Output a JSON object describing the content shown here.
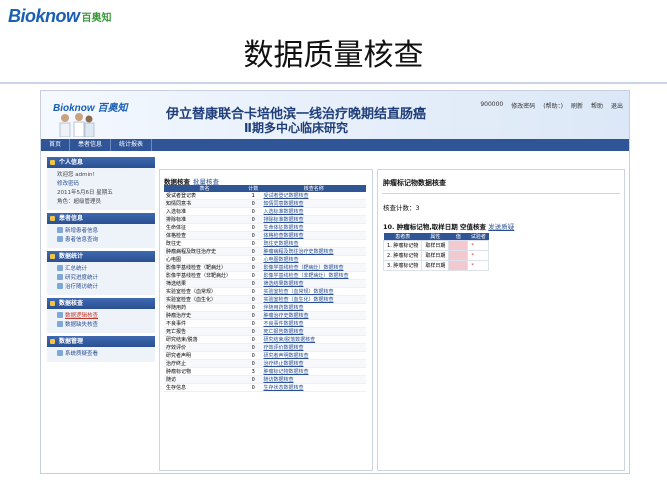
{
  "slide": {
    "logo_text": "Bioknow",
    "logo_cn": "百奥知",
    "title": "数据质量核查"
  },
  "app": {
    "banner_logo": "Bioknow 百奥知",
    "banner_title_1": "伊立替康联合卡培他滨一线治疗晚期结直肠癌",
    "banner_title_2": "Ⅱ期多中心临床研究",
    "top_links": [
      "900000",
      "修改密码",
      "(帮助：)",
      "刷新",
      "帮助",
      "退出"
    ],
    "nav_tabs": [
      "首页",
      "患者信息",
      "统计报表"
    ]
  },
  "sidebar": {
    "sections": [
      {
        "title": "个人信息",
        "items": [
          "欢迎您 admin!",
          "修改密码",
          "2011年5月6日 星期五",
          "角色：超级管理员"
        ]
      },
      {
        "title": "患者信息",
        "items": [
          "新增患者信息",
          "患者信息查询"
        ]
      },
      {
        "title": "数据统计",
        "items": [
          "汇总统计",
          "研究进度统计",
          "治疗随访统计"
        ]
      },
      {
        "title": "数据核查",
        "items": [
          "数据逻辑核查",
          "数据缺失核查"
        ]
      },
      {
        "title": "数据管理",
        "items": [
          "系统质疑查看"
        ]
      }
    ]
  },
  "check_panel": {
    "title": "数据核查",
    "title_link": "批量核查",
    "columns": [
      "表名",
      "计数",
      "核查名称"
    ],
    "rows": [
      [
        "受试者登记表",
        "1",
        "受试者登记数据核查"
      ],
      [
        "知情同意书",
        "0",
        "知情同意数据核查"
      ],
      [
        "入选标准",
        "0",
        "入选标准数据核查"
      ],
      [
        "排除标准",
        "0",
        "排除标准数据核查"
      ],
      [
        "生命体征",
        "0",
        "生命体征数据核查"
      ],
      [
        "体格检查",
        "0",
        "体格检查数据核查"
      ],
      [
        "既往史",
        "0",
        "既往史数据核查"
      ],
      [
        "肿瘤病程及既往治疗史",
        "0",
        "肿瘤病程及既往治疗史数据核查"
      ],
      [
        "心电图",
        "0",
        "心电图数据核查"
      ],
      [
        "影像学基线检查（靶病灶）",
        "0",
        "影像学基线检查（靶病灶）数据核查"
      ],
      [
        "影像学基线检查（非靶病灶）",
        "0",
        "影像学基线检查（非靶病灶）数据核查"
      ],
      [
        "筛选结果",
        "0",
        "筛选结果数据核查"
      ],
      [
        "实验室检查（血常规）",
        "0",
        "实验室检查（血常规）数据核查"
      ],
      [
        "实验室检查（血生化）",
        "0",
        "实验室检查（血生化）数据核查"
      ],
      [
        "伴随用药",
        "0",
        "伴随用药数据核查"
      ],
      [
        "肿瘤治疗史",
        "0",
        "肿瘤治疗史数据核查"
      ],
      [
        "不良事件",
        "0",
        "不良事件数据核查"
      ],
      [
        "死亡报告",
        "0",
        "死亡报告数据核查"
      ],
      [
        "研究结束/脱落",
        "0",
        "研究结束/脱落数据核查"
      ],
      [
        "疗效评价",
        "0",
        "疗效评价数据核查"
      ],
      [
        "研究者声明",
        "0",
        "研究者声明数据核查"
      ],
      [
        "治疗终止",
        "0",
        "治疗终止数据核查"
      ],
      [
        "肿瘤标记物",
        "3",
        "肿瘤标记物数据核查"
      ],
      [
        "随访",
        "0",
        "随访数据核查"
      ],
      [
        "生存信息",
        "0",
        "生存状态数据核查"
      ]
    ]
  },
  "detail_panel": {
    "title": "肿瘤标记物数据核查",
    "count_label": "核查计数：3",
    "question": "10. 肿瘤标记物,取样日期 空值核查",
    "question_link": "发送质疑",
    "columns": [
      "患者表",
      "属性",
      "值",
      "试验者"
    ],
    "rows": [
      [
        "1",
        "肿瘤标记物",
        "取样日期",
        "",
        "*"
      ],
      [
        "2",
        "肿瘤标记物",
        "取样日期",
        "",
        "*"
      ],
      [
        "3",
        "肿瘤标记物",
        "取样日期",
        "",
        "*"
      ]
    ]
  }
}
